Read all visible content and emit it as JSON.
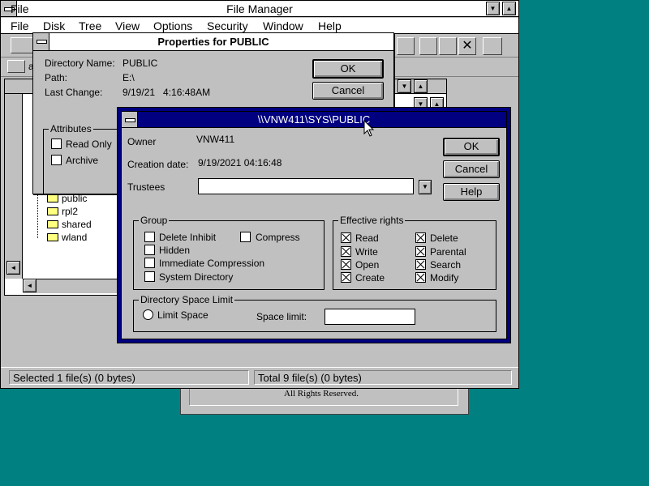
{
  "background_color": "#008080",
  "back_window": {
    "text": "All Rights Reserved."
  },
  "file_manager": {
    "title": "File Manager",
    "menu": [
      "File",
      "Disk",
      "Tree",
      "View",
      "Options",
      "Security",
      "Window",
      "Help"
    ],
    "tree_items": [
      "public",
      "rpl2",
      "shared",
      "wland"
    ],
    "status_left": "Selected 1 file(s) (0 bytes)",
    "status_right": "Total 9 file(s) (0 bytes)",
    "drive_label": "a"
  },
  "properties_dialog": {
    "title": "Properties for PUBLIC",
    "directory_name_label": "Directory Name:",
    "directory_name_value": "PUBLIC",
    "path_label": "Path:",
    "path_value": "E:\\",
    "last_change_label": "Last Change:",
    "last_change_value": "9/19/21   4:16:48AM",
    "ok_label": "OK",
    "cancel_label": "Cancel",
    "attributes_label": "Attributes",
    "read_only_label": "Read Only",
    "archive_label": "Archive"
  },
  "netware_dialog": {
    "title": "\\\\VNW411\\SYS\\PUBLIC",
    "owner_label": "Owner",
    "owner_value": "VNW411",
    "creation_label": "Creation date:",
    "creation_value": "9/19/2021 04:16:48",
    "trustees_label": "Trustees",
    "trustees_value": "",
    "ok_label": "OK",
    "cancel_label": "Cancel",
    "help_label": "Help",
    "group_label": "Group",
    "group_items": [
      {
        "label": "Delete Inhibit",
        "checked": false
      },
      {
        "label": "Compress",
        "checked": false
      },
      {
        "label": "Hidden",
        "checked": false
      },
      {
        "label": "Immediate Compression",
        "checked": false
      },
      {
        "label": "System Directory",
        "checked": false
      }
    ],
    "rights_label": "Effective rights",
    "rights": [
      {
        "label": "Read",
        "checked": true
      },
      {
        "label": "Delete",
        "checked": true
      },
      {
        "label": "Write",
        "checked": true
      },
      {
        "label": "Parental",
        "checked": true
      },
      {
        "label": "Open",
        "checked": true
      },
      {
        "label": "Search",
        "checked": true
      },
      {
        "label": "Create",
        "checked": true
      },
      {
        "label": "Modify",
        "checked": true
      }
    ],
    "space_group_label": "Directory Space Limit",
    "limit_space_label": "Limit Space",
    "space_limit_label": "Space limit:",
    "space_limit_value": ""
  }
}
